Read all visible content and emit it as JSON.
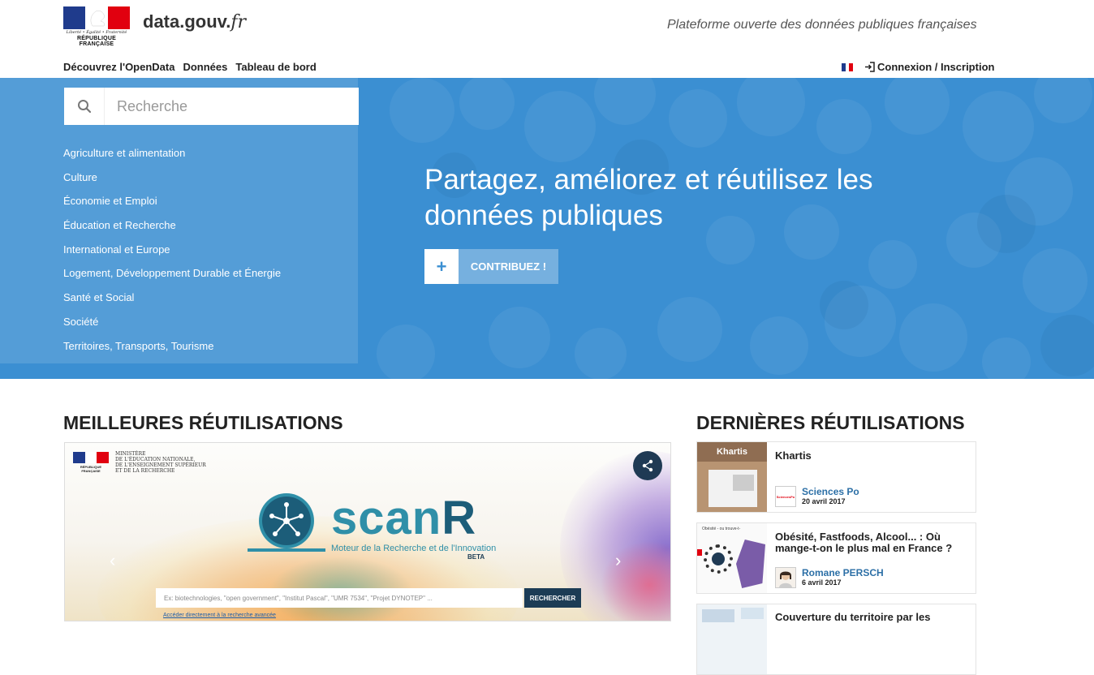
{
  "header": {
    "logo": {
      "motto": "Liberté • Égalité • Fraternité",
      "republic": "RÉPUBLIQUE FRANÇAISE"
    },
    "brand": {
      "name": "data.gouv.",
      "tld": "fr"
    },
    "tagline": "Plateforme ouverte des données publiques françaises",
    "nav": [
      "Découvrez l'OpenData",
      "Données",
      "Tableau de bord"
    ],
    "login_label": "Connexion / Inscription",
    "language_flag": "fr-flag-icon"
  },
  "hero": {
    "search_placeholder": "Recherche",
    "topics": [
      "Agriculture et alimentation",
      "Culture",
      "Économie et Emploi",
      "Éducation et Recherche",
      "International et Europe",
      "Logement, Développement Durable et Énergie",
      "Santé et Social",
      "Société",
      "Territoires, Transports, Tourisme"
    ],
    "title": "Partagez, améliorez et réutilisez les données publiques",
    "contribute_icon": "+",
    "contribute_label": "CONTRIBUEZ !"
  },
  "best": {
    "title": "MEILLEURES RÉUTILISATIONS",
    "feature": {
      "ministry_lines": [
        "Ministère",
        "de l'Éducation nationale,",
        "de l'Enseignement supérieur",
        "et de la Recherche"
      ],
      "logo_rf": "RÉPUBLIQUE FRANÇAISE",
      "product_name": "scan",
      "product_name_r": "R",
      "subtitle": "Moteur de la Recherche et de l'Innovation",
      "beta": "BETA",
      "search_placeholder": "Ex: biotechnologies, \"open government\", \"Institut Pascal\", \"UMR 7534\", \"Projet DYNOTEP\" ...",
      "search_button": "RECHERCHER",
      "advanced_link": "Accéder directement à la recherche avancée",
      "prev_arrow": "‹",
      "next_arrow": "›"
    }
  },
  "latest": {
    "title": "DERNIÈRES RÉUTILISATIONS",
    "items": [
      {
        "title": "Khartis",
        "thumb_label": "Khartis",
        "org": "Sciences Po",
        "org_logo_text": "SciencesPo",
        "date": "20 avril 2017"
      },
      {
        "title": "Obésité, Fastfoods, Alcool... : Où mange-t-on le plus mal en France ?",
        "thumb_label": "Obésité - ou trouve-t-",
        "org": "Romane PERSCH",
        "date": "6 avril 2017"
      },
      {
        "title": "Couverture du territoire par les",
        "thumb_label": "",
        "org": "",
        "date": ""
      }
    ]
  },
  "colors": {
    "hero_blue": "#3b8fd2",
    "link_blue": "#2c6fa6",
    "scanr_teal": "#2f8fa8",
    "flag_blue": "#1f3b8c",
    "flag_red": "#e1000f"
  }
}
